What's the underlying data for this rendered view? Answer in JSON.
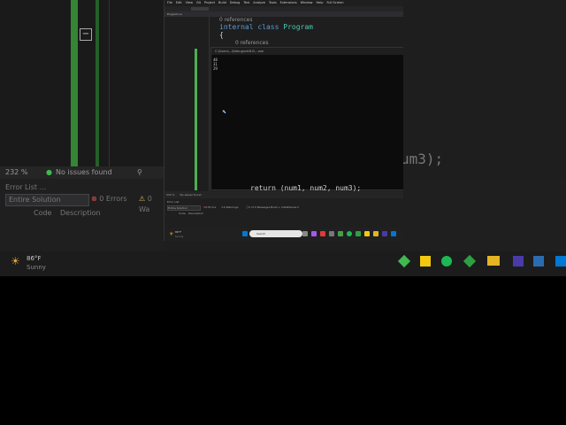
{
  "background": {
    "zoom": "232 %",
    "issues": "No issues found",
    "error_list_title": "Error List ...",
    "scope": "Entire Solution",
    "errors": "0 Errors",
    "warnings": "0 Wa",
    "col_code": "Code",
    "col_description": "Description",
    "weather_temp": "86°F",
    "weather_desc": "Sunny",
    "right_code": "um3);"
  },
  "window": {
    "menu": [
      "File",
      "Edit",
      "View",
      "Git",
      "Project",
      "Build",
      "Debug",
      "Test",
      "Analyze",
      "Tools",
      "Extensions",
      "Window",
      "Help",
      "Full Screen"
    ],
    "doc_tab": "Program.cs",
    "code": {
      "ref1": "0 references",
      "line1_kw": "internal class",
      "line1_cls": "Program",
      "brace": "{",
      "ref2": "0 references",
      "return_line": "return (num1, num2, num3);"
    },
    "console": {
      "title": "C:\\Users\\...\\Debug\\net8.0\\...exe",
      "output": [
        "48",
        "31",
        "29"
      ]
    },
    "status": {
      "zoom": "232 %",
      "issues": "No issues found"
    },
    "errorlist": {
      "title": "Error List",
      "scope": "Entire Solution",
      "errors": "0 Errors",
      "warnings": "0 Warnings",
      "messages": "0 of 0 Messages",
      "build": "Build + IntelliSense",
      "col_code": "Code",
      "col_description": "Description"
    },
    "taskbar": {
      "weather": "86°F",
      "weather_desc": "Sunny",
      "search_placeholder": "Search"
    }
  },
  "colors": {
    "accent_green": "#4caf50",
    "keyword": "#569cd6",
    "class": "#4ec9b0"
  }
}
